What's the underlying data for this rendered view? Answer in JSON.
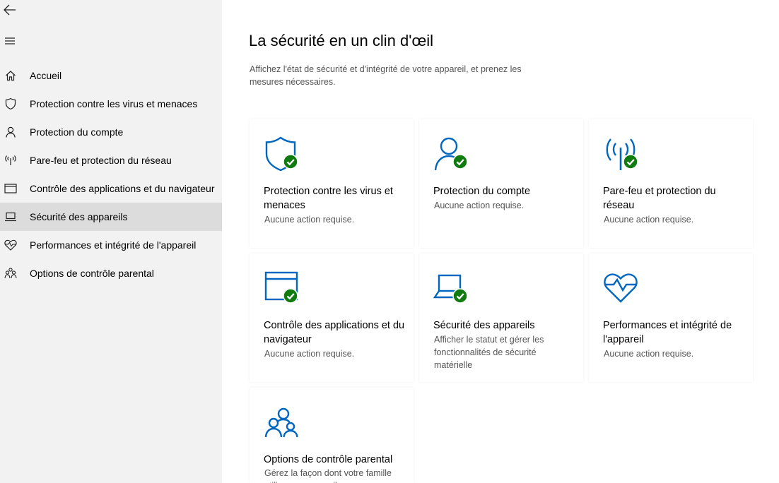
{
  "colors": {
    "accent": "#0067c0",
    "ok": "#107c10",
    "sidebar_bg": "#f2f2f2",
    "active_bg": "#dcdcdc"
  },
  "sidebar": {
    "back_icon": "arrow-left-icon",
    "menu_icon": "hamburger-icon",
    "items": [
      {
        "label": "Accueil",
        "icon": "home-icon"
      },
      {
        "label": "Protection contre les virus et menaces",
        "icon": "shield-icon"
      },
      {
        "label": "Protection du compte",
        "icon": "person-icon"
      },
      {
        "label": "Pare-feu et protection du réseau",
        "icon": "antenna-icon"
      },
      {
        "label": "Contrôle des applications et du navigateur",
        "icon": "browser-window-icon"
      },
      {
        "label": "Sécurité des appareils",
        "icon": "laptop-icon",
        "active": true
      },
      {
        "label": "Performances et intégrité de l'appareil",
        "icon": "heart-pulse-icon"
      },
      {
        "label": "Options de contrôle parental",
        "icon": "family-icon"
      }
    ]
  },
  "main": {
    "title": "La sécurité en un clin d'œil",
    "subtitle": "Affichez l'état de sécurité et d'intégrité de votre appareil, et prenez les mesures nécessaires.",
    "tiles": [
      {
        "title": "Protection contre les virus et menaces",
        "status": "Aucune action requise.",
        "icon": "shield-check-icon"
      },
      {
        "title": "Protection du compte",
        "status": "Aucune action requise.",
        "icon": "person-check-icon"
      },
      {
        "title": "Pare-feu et protection du réseau",
        "status": "Aucune action requise.",
        "icon": "antenna-check-icon"
      },
      {
        "title": "Contrôle des applications et du navigateur",
        "status": "Aucune action requise.",
        "icon": "browser-check-icon"
      },
      {
        "title": "Sécurité des appareils",
        "status": "Afficher le statut et gérer les fonctionnalités de sécurité matérielle",
        "icon": "laptop-check-icon"
      },
      {
        "title": "Performances et intégrité de l'appareil",
        "status": "Aucune action requise.",
        "icon": "heart-pulse-icon"
      },
      {
        "title": "Options de contrôle parental",
        "status": "Gérez la façon dont votre famille utilise ses appareils.",
        "icon": "family-icon"
      }
    ]
  }
}
